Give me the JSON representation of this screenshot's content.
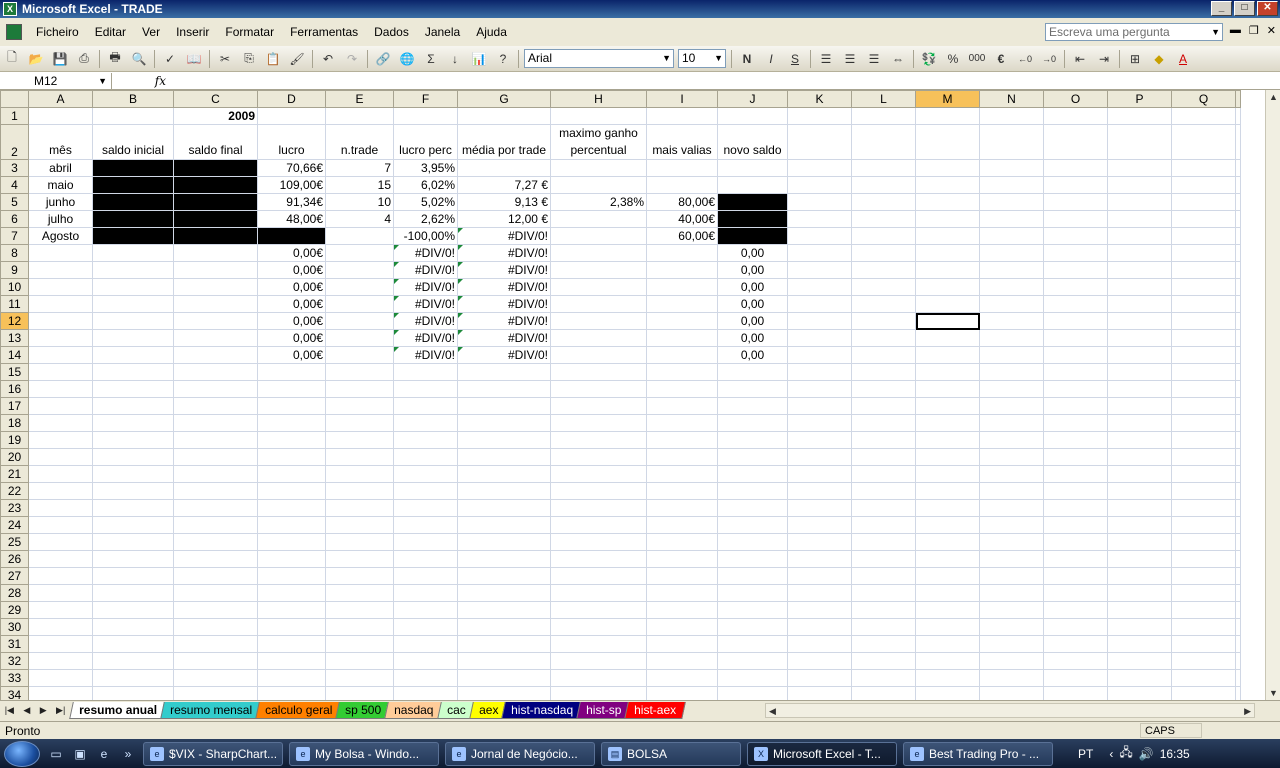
{
  "window": {
    "title": "Microsoft Excel - TRADE",
    "app_icon": "excel-icon"
  },
  "menubar": {
    "items": [
      "Ficheiro",
      "Editar",
      "Ver",
      "Inserir",
      "Formatar",
      "Ferramentas",
      "Dados",
      "Janela",
      "Ajuda"
    ],
    "ask_placeholder": "Escreva uma pergunta"
  },
  "toolbar": {
    "font": "Arial",
    "size": "10",
    "bold": "N",
    "italic": "I",
    "underline": "S",
    "percent": "%",
    "thousands": "000",
    "euro": "€",
    "sigma": "Σ"
  },
  "formula": {
    "cell_ref": "M12",
    "fx": "fx",
    "content": ""
  },
  "sheet": {
    "columns": [
      "A",
      "B",
      "C",
      "D",
      "E",
      "F",
      "G",
      "H",
      "I",
      "J",
      "K",
      "L",
      "M",
      "N",
      "O",
      "P",
      "Q"
    ],
    "selected_column": "M",
    "selected_row": 12,
    "title_year": "2009",
    "headers": {
      "A": "mês",
      "B": "saldo inicial",
      "C": "saldo final",
      "D": "lucro",
      "E": "n.trade",
      "F": "lucro perc",
      "G": "média por trade",
      "H": "maximo ganho percentual",
      "I": "mais valias",
      "J": "novo saldo"
    },
    "rows": [
      {
        "row": 3,
        "A": "abril",
        "D": "70,66€",
        "E": "7",
        "F": "3,95%",
        "G": "",
        "H": "",
        "I": "",
        "J": ""
      },
      {
        "row": 4,
        "A": "maio",
        "D": "109,00€",
        "E": "15",
        "F": "6,02%",
        "G": "7,27 €",
        "H": "",
        "I": "",
        "J": ""
      },
      {
        "row": 5,
        "A": "junho",
        "D": "91,34€",
        "E": "10",
        "F": "5,02%",
        "G": "9,13 €",
        "H": "2,38%",
        "I": "80,00€",
        "J": ""
      },
      {
        "row": 6,
        "A": "julho",
        "D": "48,00€",
        "E": "4",
        "F": "2,62%",
        "G": "12,00 €",
        "H": "",
        "I": "40,00€",
        "J": ""
      },
      {
        "row": 7,
        "A": "Agosto",
        "D": "",
        "E": "",
        "F": "-100,00%",
        "G": "#DIV/0!",
        "H": "",
        "I": "60,00€",
        "J": ""
      },
      {
        "row": 8,
        "A": "",
        "D": "0,00€",
        "E": "",
        "F": "#DIV/0!",
        "G": "#DIV/0!",
        "H": "",
        "I": "",
        "J": "0,00"
      },
      {
        "row": 9,
        "A": "",
        "D": "0,00€",
        "E": "",
        "F": "#DIV/0!",
        "G": "#DIV/0!",
        "H": "",
        "I": "",
        "J": "0,00"
      },
      {
        "row": 10,
        "A": "",
        "D": "0,00€",
        "E": "",
        "F": "#DIV/0!",
        "G": "#DIV/0!",
        "H": "",
        "I": "",
        "J": "0,00"
      },
      {
        "row": 11,
        "A": "",
        "D": "0,00€",
        "E": "",
        "F": "#DIV/0!",
        "G": "#DIV/0!",
        "H": "",
        "I": "",
        "J": "0,00"
      },
      {
        "row": 12,
        "A": "",
        "D": "0,00€",
        "E": "",
        "F": "#DIV/0!",
        "G": "#DIV/0!",
        "H": "",
        "I": "",
        "J": "0,00"
      },
      {
        "row": 13,
        "A": "",
        "D": "0,00€",
        "E": "",
        "F": "#DIV/0!",
        "G": "#DIV/0!",
        "H": "",
        "I": "",
        "J": "0,00"
      },
      {
        "row": 14,
        "A": "",
        "D": "0,00€",
        "E": "",
        "F": "#DIV/0!",
        "G": "#DIV/0!",
        "H": "",
        "I": "",
        "J": "0,00"
      }
    ],
    "last_row": 34
  },
  "sheet_tabs": [
    {
      "label": "resumo anual",
      "color": "#ffffff",
      "active": true
    },
    {
      "label": "resumo mensal",
      "color": "#33cccc"
    },
    {
      "label": "calculo geral",
      "color": "#ff8000"
    },
    {
      "label": "sp 500",
      "color": "#33cc33"
    },
    {
      "label": "nasdaq",
      "color": "#ffcc99"
    },
    {
      "label": "cac",
      "color": "#ccffcc"
    },
    {
      "label": "aex",
      "color": "#ffff00"
    },
    {
      "label": "hist-nasdaq",
      "color": "#000080"
    },
    {
      "label": "hist-sp",
      "color": "#800080"
    },
    {
      "label": "hist-aex",
      "color": "#ff0000"
    }
  ],
  "status": {
    "text": "Pronto",
    "caps": "CAPS"
  },
  "taskbar": {
    "buttons": [
      {
        "label": "$VIX - SharpChart...",
        "icon": "ie-icon"
      },
      {
        "label": "My Bolsa - Windo...",
        "icon": "ie-icon"
      },
      {
        "label": "Jornal de Negócio...",
        "icon": "ie-icon"
      },
      {
        "label": "BOLSA",
        "icon": "folder-icon"
      },
      {
        "label": "Microsoft Excel - T...",
        "icon": "excel-icon",
        "active": true
      },
      {
        "label": "Best Trading Pro - ...",
        "icon": "app-icon"
      }
    ],
    "lang": "PT",
    "clock": "16:35"
  }
}
